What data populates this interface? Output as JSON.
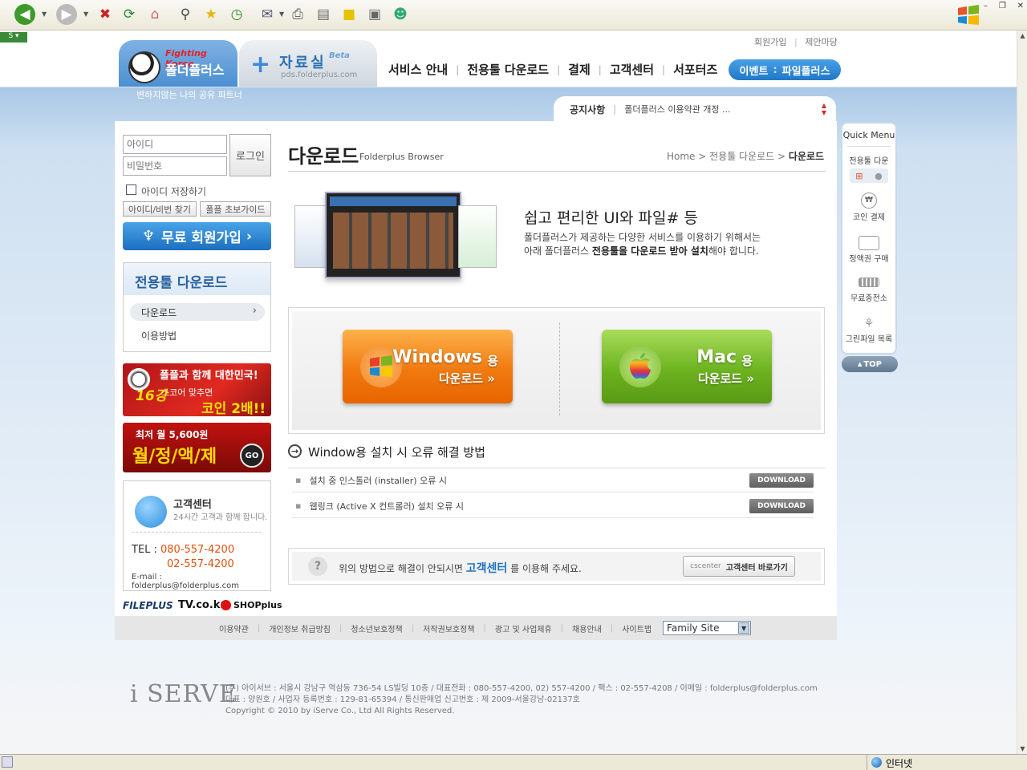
{
  "browser": {
    "status_text": "인터넷"
  },
  "header": {
    "brand_en": "Fighting Korea",
    "brand_ko": "폴더플러스",
    "pds_title": "자료실",
    "pds_beta": "Beta",
    "pds_url": "pds.folderplus.com",
    "top_links": [
      "회원가입",
      "제안마당"
    ],
    "nav": [
      "서비스 안내",
      "전용툴 다운로드",
      "결제",
      "고객센터",
      "서포터즈"
    ],
    "event_btn": {
      "left": "이벤트",
      "right": "파일플러스"
    },
    "tagline": "변하지않는 나의 공유 파트너",
    "notice_label": "공지사항",
    "notice_text": "폴더플러스 이용약관 개정 ..."
  },
  "login": {
    "id_placeholder": "아이디",
    "pw_placeholder": "비밀번호",
    "login_btn": "로그인",
    "save_id": "아이디 저장하기",
    "find_btn": "아이디/비번 찾기",
    "guide_btn": "폴플 초보가이드",
    "join_btn": "무료 회원가입"
  },
  "sidemenu": {
    "title": "전용툴 다운로드",
    "items": [
      "다운로드",
      "이용방법"
    ]
  },
  "banners": {
    "b1_line1": "폴플과 함께 대한민국!",
    "b1_score": "16강",
    "b1_line2": "스코어 맞추면",
    "b1_line3": "코인 2배!!",
    "b2_line1": "최저 월 5,600원",
    "b2_line2": "월/정/액/제",
    "b2_go": "GO"
  },
  "cs": {
    "title": "고객센터",
    "sub": "24시간 고객과 함께 합니다.",
    "tel_label": "TEL  :",
    "tel1": "080-557-4200",
    "tel2": "02-557-4200",
    "email": "E-mail : folderplus@folderplus.com"
  },
  "partners": [
    "FILEPLUS",
    "TV.co.kr",
    "SHOPplus"
  ],
  "content": {
    "title": "다운로드",
    "subtitle": "Folderplus Browser",
    "breadcrumb": [
      "Home",
      "전용툴 다운로드",
      "다운로드"
    ],
    "hero_title": "쉽고 편리한 UI와 파일# 등",
    "hero_line1": "폴더플러스가 제공하는 다양한 서비스를 이용하기 위해서는",
    "hero_line2_a": "아래 폴더플러스 ",
    "hero_line2_b": "전용툴을 다운로드 받아 설치",
    "hero_line2_c": "해야 합니다.",
    "win_btn": {
      "big": "Windows",
      "suffix": "용",
      "small": "다운로드 »"
    },
    "mac_btn": {
      "big": "Mac",
      "suffix": "용",
      "small": "다운로드 »"
    },
    "fix_title": "Window용 설치 시 오류 해결 방법",
    "fix_rows": [
      {
        "text": "설치 중 인스톨러 (installer) 오류 시",
        "btn": "DOWNLOAD"
      },
      {
        "text": "웹링크 (Active X 컨트롤러) 설치 오류 시",
        "btn": "DOWNLOAD"
      }
    ],
    "help_a": "위의 방법으로 해결이 안되시면 ",
    "help_link": "고객센터",
    "help_b": " 를 이용해 주세요.",
    "help_btn_en": "cscenter",
    "help_btn_ko": "고객센터 바로가기"
  },
  "quick": {
    "title": "Quick Menu",
    "items": [
      "전용툴 다운",
      "코인 결제",
      "정액권 구매",
      "무료충전소",
      "그린파일 목록"
    ],
    "top": "TOP"
  },
  "footer": {
    "links": [
      "이용약관",
      "개인정보 취급방침",
      "청소년보호정책",
      "저작권보호정책",
      "광고 및 사업제휴",
      "채용안내",
      "사이트맵"
    ],
    "family_site": "Family Site",
    "logo": "i SERVE",
    "info1": "(주) 아이서브 : 서울시 강남구 역삼동 736-54 LS빌딩 10층 / 대표전화 : 080-557-4200, 02) 557-4200 / 팩스 : 02-557-4208 / 이메일 : folderplus@folderplus.com",
    "info2": "대표 : 양원호 / 사업자 등록번호 : 129-81-65394 / 통신판매업 신고번호 : 제 2009-서울강남-02137호",
    "info3": "Copyright © 2010 by iServe Co., Ltd All Rights Reserved."
  },
  "colors": {
    "accent": "#1f78c8",
    "orange": "#f07a10",
    "green": "#6cb31f",
    "tel": "#e0520e"
  }
}
